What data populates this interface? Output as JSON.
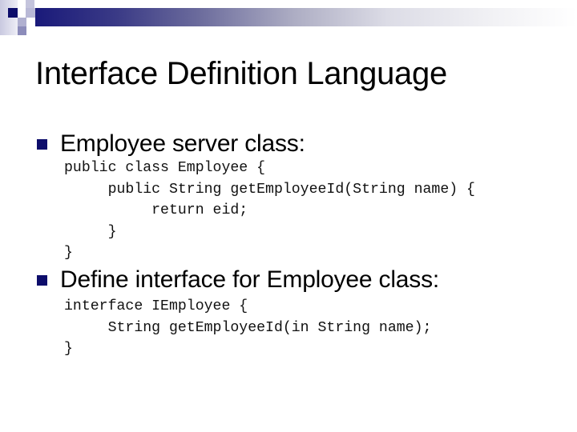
{
  "slide": {
    "title": "Interface Definition Language",
    "bullets": [
      {
        "text": "Employee server class:",
        "code": [
          "public class Employee {",
          "     public String getEmployeeId(String name) {",
          "          return eid;",
          "     }",
          "}"
        ]
      },
      {
        "text": "Define interface for Employee class:",
        "code": [
          "interface IEmployee {",
          "     String getEmployeeId(in String name);",
          "}"
        ]
      }
    ]
  },
  "theme": {
    "accent": "#0d0d6b",
    "bar_start": "#1a1a7a",
    "bar_end": "#ffffff"
  }
}
